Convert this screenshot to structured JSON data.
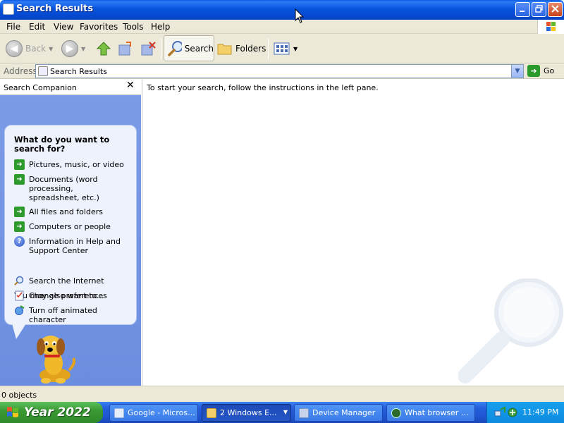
{
  "window": {
    "title": "Search Results"
  },
  "menu": [
    "File",
    "Edit",
    "View",
    "Favorites",
    "Tools",
    "Help"
  ],
  "toolbar": {
    "back_label": "Back",
    "search_label": "Search",
    "folders_label": "Folders"
  },
  "address": {
    "label": "Address",
    "value": "Search Results",
    "go_label": "Go"
  },
  "search_companion": {
    "title": "Search Companion",
    "close_glyph": "✕",
    "question": "What do you want to search for?",
    "options": [
      "Pictures, music, or video",
      "Documents (word processing, spreadsheet, etc.)",
      "All files and folders",
      "Computers or people",
      "Information in Help and Support Center"
    ],
    "also_heading": "You may also want to...",
    "also_options": [
      "Search the Internet",
      "Change preferences",
      "Turn off animated character"
    ]
  },
  "main": {
    "message": "To start your search, follow the instructions in the left pane."
  },
  "status": {
    "text": "0 objects"
  },
  "taskbar": {
    "start_label": "Year 2022",
    "tasks": [
      "Google - Micros...",
      "2 Windows E...",
      "Device Manager",
      "What browser ..."
    ],
    "clock": "11:49 PM"
  },
  "colors": {
    "titlebar_blue": "#0855dd",
    "pane_blue": "#6b8ee0",
    "start_green": "#3a9a34",
    "arrow_green": "#2e9a2e"
  }
}
